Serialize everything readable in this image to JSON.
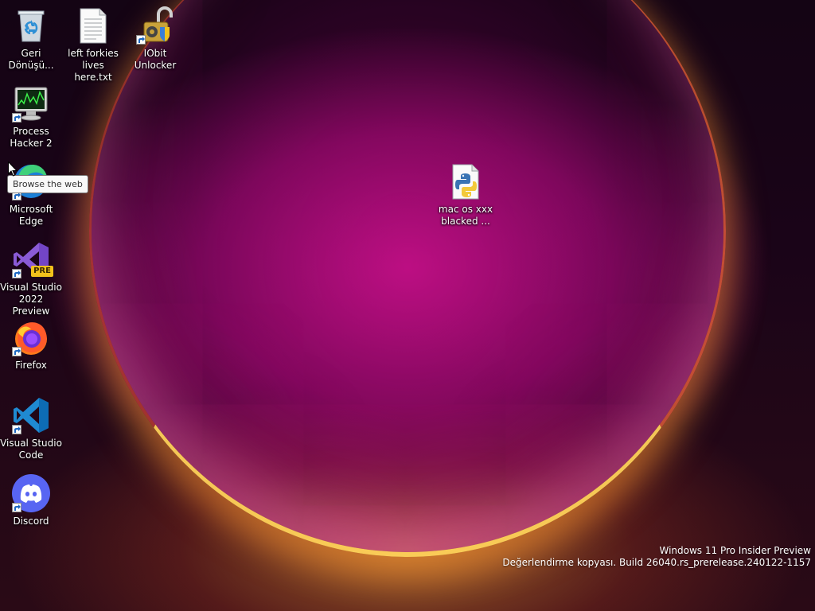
{
  "desktop": {
    "icons": [
      {
        "label": "Geri\nDönüşü...",
        "icon": "recycle-bin-icon"
      },
      {
        "label": "left forkies\nlives here.txt",
        "icon": "text-file-icon"
      },
      {
        "label": "IObit\nUnlocker",
        "icon": "iobit-unlocker-icon"
      },
      {
        "label": "Process\nHacker 2",
        "icon": "process-hacker-icon"
      },
      {
        "label": "Microsoft\nEdge",
        "icon": "edge-icon"
      },
      {
        "label": "Visual Studio\n2022 Preview",
        "icon": "visual-studio-preview-icon",
        "badge": "PRE"
      },
      {
        "label": "Firefox",
        "icon": "firefox-icon"
      },
      {
        "label": "Visual Studio\nCode",
        "icon": "vscode-icon"
      },
      {
        "label": "Discord",
        "icon": "discord-icon"
      },
      {
        "label": "mac os xxx\nblacked ...",
        "icon": "python-file-icon"
      }
    ]
  },
  "tooltip": {
    "text": "Browse the web"
  },
  "watermark": {
    "line1": "Windows 11 Pro Insider Preview",
    "line2": "Değerlendirme kopyası. Build 26040.rs_prerelease.240122-1157"
  },
  "colors": {
    "vscode_blue": "#1f8ad2",
    "discord_blurple": "#5865f2",
    "vs_purple": "#8a5bd6",
    "pre_badge": "#f2c21b"
  }
}
